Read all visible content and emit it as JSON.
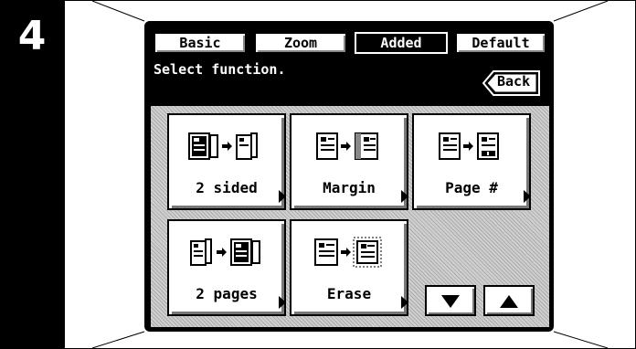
{
  "step": {
    "number": "4"
  },
  "tabs": [
    {
      "label": "Basic",
      "active": false
    },
    {
      "label": "Zoom",
      "active": false
    },
    {
      "label": "Added",
      "active": true
    },
    {
      "label": "Default",
      "active": false
    }
  ],
  "message": "Select function.",
  "back_label": "Back",
  "functions": [
    {
      "label": "2 sided",
      "icon": "duplex-icon"
    },
    {
      "label": "Margin",
      "icon": "margin-icon"
    },
    {
      "label": "Page #",
      "icon": "page-number-icon"
    },
    {
      "label": "2 pages",
      "icon": "two-pages-icon"
    },
    {
      "label": "Erase",
      "icon": "erase-icon"
    }
  ],
  "scroll": {
    "down_icon": "arrow-down-icon",
    "up_icon": "arrow-up-icon"
  }
}
